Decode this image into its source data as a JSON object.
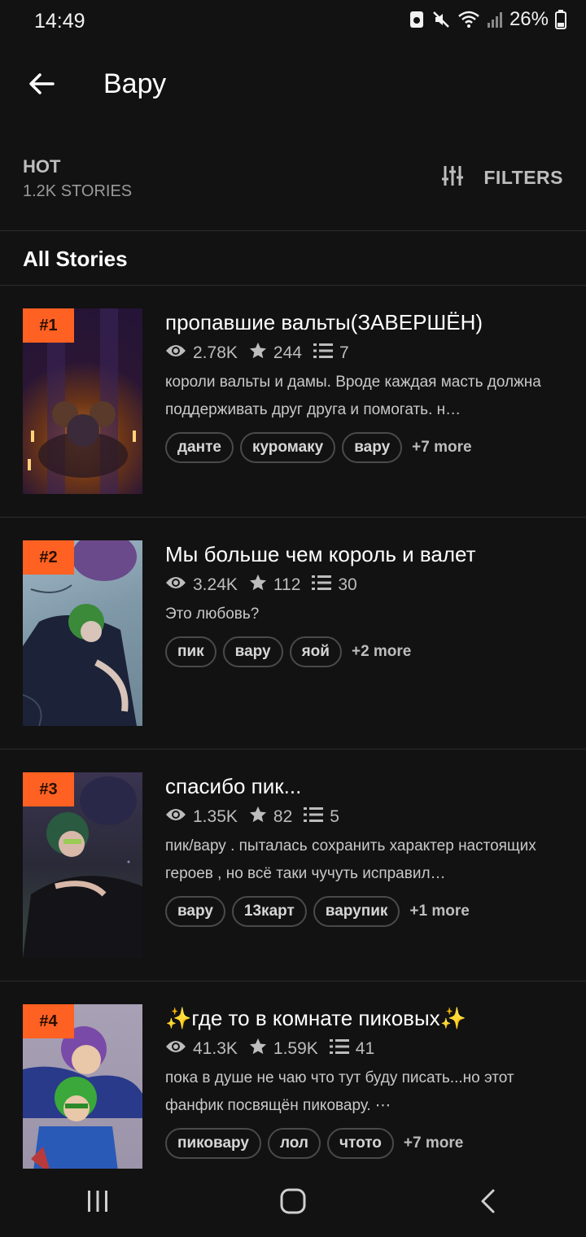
{
  "status": {
    "time": "14:49",
    "battery": "26%"
  },
  "header": {
    "title": "Вару"
  },
  "sort": {
    "label": "HOT",
    "count": "1.2K STORIES",
    "filters_label": "FILTERS"
  },
  "section": {
    "title": "All Stories"
  },
  "stories": [
    {
      "rank": "#1",
      "title": "пропавшие вальты(ЗАВЕРШЁН)",
      "reads": "2.78K",
      "votes": "244",
      "parts": "7",
      "description": "короли вальты и дамы. Вроде каждая масть должна поддерживать друг друга и помогать. н…",
      "tags": [
        "данте",
        "куромаку",
        "вару"
      ],
      "more": "+7 more"
    },
    {
      "rank": "#2",
      "title": "Мы больше чем король и валет",
      "reads": "3.24K",
      "votes": "112",
      "parts": "30",
      "description": "Это любовь?",
      "tags": [
        "пик",
        "вару",
        "яой"
      ],
      "more": "+2 more"
    },
    {
      "rank": "#3",
      "title": "спасибо пик...",
      "reads": "1.35K",
      "votes": "82",
      "parts": "5",
      "description": "пик/вару . пыталась сохранить характер настоящих героев , но всё таки чучуть исправил…",
      "tags": [
        "вару",
        "13карт",
        "варупик"
      ],
      "more": "+1 more"
    },
    {
      "rank": "#4",
      "title": "✨где то в комнате пиковых✨",
      "reads": "41.3K",
      "votes": "1.59K",
      "parts": "41",
      "description": "пока в душе не чаю что тут буду писать...но этот фанфик посвящён пиковару. ⋯",
      "tags": [
        "пиковару",
        "лол",
        "чтото"
      ],
      "more": "+7 more"
    }
  ],
  "icons": {
    "back": "arrow-left-icon",
    "filters": "sliders-icon",
    "reads": "eye-icon",
    "votes": "star-icon",
    "parts": "list-icon"
  },
  "colors": {
    "accent": "#ff6122",
    "background": "#121212"
  }
}
